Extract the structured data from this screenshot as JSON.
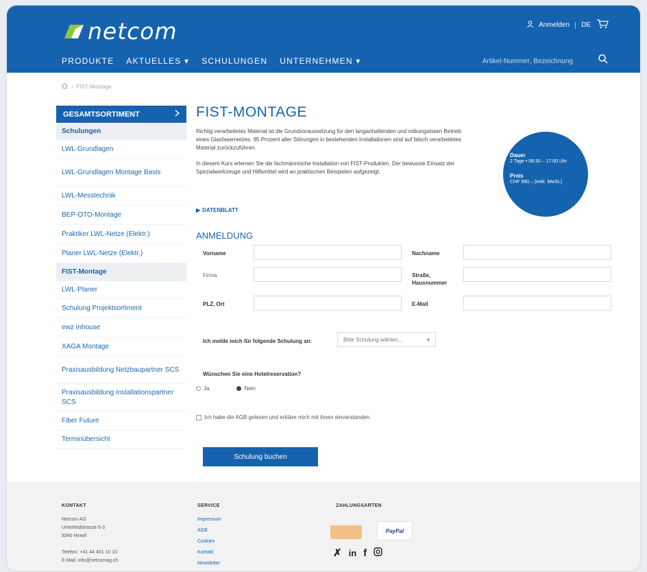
{
  "header": {
    "brand": "netcom",
    "login": "Anmelden",
    "lang": "DE",
    "nav": [
      "PRODUKTE",
      "AKTUELLES ▾",
      "SCHULUNGEN",
      "UNTERNEHMEN ▾"
    ],
    "search_placeholder": "Artikel-Nummer, Bezeichnung"
  },
  "breadcrumb": "FIST-Montage",
  "sidebar": {
    "heading": "GESAMTSORTIMENT",
    "sub": "Schulungen",
    "items": [
      "LWL-Grundlagen",
      "LWL-Grundlagen Montage Basis",
      "LWL-Messtechnik",
      "BEP-OTO-Montage",
      "Praktiker LWL-Netze (Elektr.)",
      "Planer LWL-Netze (Elektr.)",
      "FIST-Montage",
      "LWL-Planer",
      "Schulung Projektsortiment",
      "ewz Inhouse",
      "XAGA Montage",
      "Praxisausbildung Netzbaupartner SCS",
      "Praxisausbildung Installationspartner SCS",
      "Fiber Future",
      "Terminübersicht"
    ],
    "active_index": 6
  },
  "main": {
    "title": "FIST-MONTAGE",
    "intro1": "Richtig verarbeitetes Material ist die Grundvoraussetzung für den langanhaltenden und reibungslosen Betrieb eines Glasfasernetzes. 95 Prozent aller Störungen in bestehenden Installationen sind auf falsch verarbeitetes Material zurückzuführen.",
    "intro2": "In diesem Kurs erlernen Sie die fachmännische Installation von FIST-Produkten. Der bewusste Einsatz der Spezialwerkzeuge und Hilfsmittel wird an praktischen Beispielen aufgezeigt.",
    "datasheet": "DATENBLATT",
    "circle": {
      "dauer_label": "Dauer",
      "dauer_value": "2 Tage • 08:30 – 17:00 Uhr",
      "preis_label": "Preis",
      "preis_value": "CHF 990.– (exkl. MwSt.)"
    },
    "form": {
      "title": "ANMELDUNG",
      "vorname": "Vorname",
      "nachname": "Nachname",
      "firma": "Firma",
      "strasse": "Straße, Hausnummer",
      "plz": "PLZ, Ort",
      "email": "E-Mail",
      "schulung_label": "Ich melde mich für folgende Schulung an:",
      "schulung_placeholder": "Bitte Schulung wählen...",
      "hotel_label": "Wünschen Sie eine Hotelreservation?",
      "ja": "Ja",
      "nein": "Nein",
      "agb": "Ich habe die AGB gelesen und erkläre mich mit ihnen einverstanden.",
      "submit": "Schulung buchen"
    }
  },
  "footer": {
    "kontakt_title": "KONTAKT",
    "kontakt_lines": [
      "Netcom AG",
      "Unterfeldstrasse 5-3",
      "8340 Hinwil"
    ],
    "telefon": "Telefon: +41 44 401 10 10",
    "email": "E-Mail: info@netcomag.ch",
    "service_title": "SERVICE",
    "service_links": [
      "Impressum",
      "AGB",
      "Cookies",
      "Kontakt",
      "Newsletter"
    ],
    "pay_title": "ZAHLUNGSARTEN",
    "paypal": "PayPal"
  },
  "colors": {
    "brand": "#1563ae"
  }
}
